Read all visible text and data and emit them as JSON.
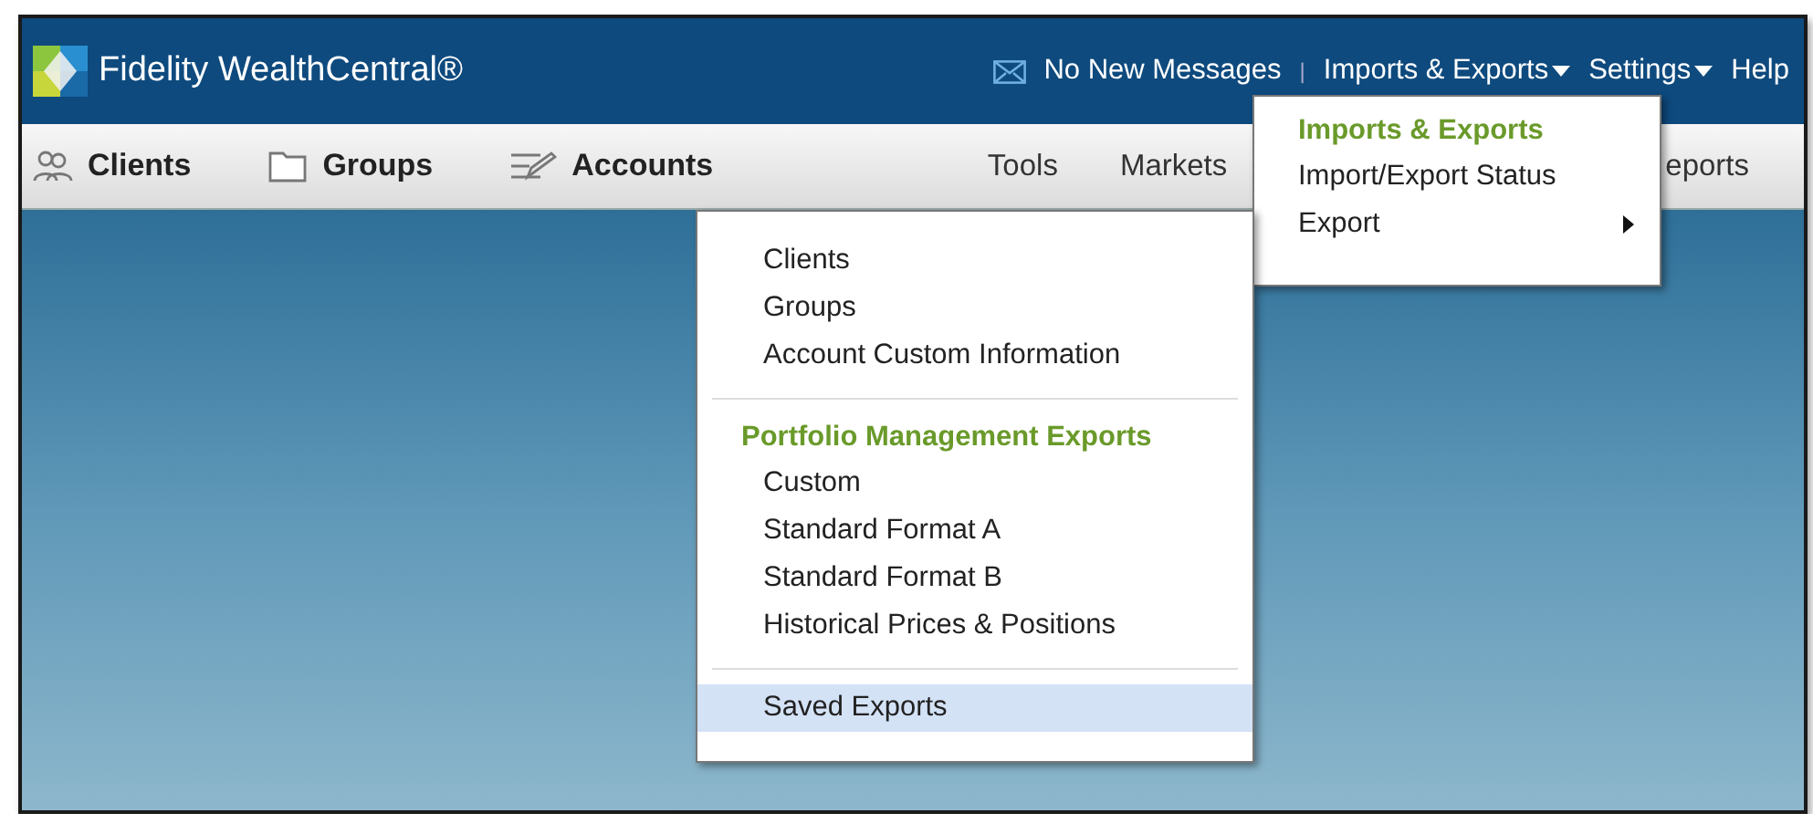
{
  "header": {
    "brand": "Fidelity WealthCentral®",
    "messages": "No New Messages",
    "separator": "|",
    "links": [
      {
        "label": "Imports & Exports",
        "dropdown": true
      },
      {
        "label": "Settings",
        "dropdown": true
      },
      {
        "label": "Help",
        "dropdown": false
      }
    ]
  },
  "nav": {
    "left": [
      {
        "label": "Clients"
      },
      {
        "label": "Groups"
      },
      {
        "label": "Accounts"
      }
    ],
    "right": [
      {
        "label": "Tools"
      },
      {
        "label": "Markets"
      }
    ],
    "cut": "eports"
  },
  "imports_menu": [
    {
      "kind": "heading",
      "label": "Imports & Exports"
    },
    {
      "kind": "item",
      "label": "Import/Export Status",
      "submenu": false,
      "selected": false
    },
    {
      "kind": "item",
      "label": "Export",
      "submenu": true,
      "selected": false
    }
  ],
  "export_menu": [
    {
      "kind": "item",
      "label": "Clients",
      "selected": false
    },
    {
      "kind": "item",
      "label": "Groups",
      "selected": false
    },
    {
      "kind": "item",
      "label": "Account Custom Information",
      "selected": false
    },
    {
      "kind": "divider"
    },
    {
      "kind": "heading",
      "label": "Portfolio Management Exports"
    },
    {
      "kind": "item",
      "label": "Custom",
      "selected": false
    },
    {
      "kind": "item",
      "label": "Standard Format A",
      "selected": false
    },
    {
      "kind": "item",
      "label": "Standard Format B",
      "selected": false
    },
    {
      "kind": "item",
      "label": "Historical Prices & Positions",
      "selected": false
    },
    {
      "kind": "divider"
    },
    {
      "kind": "item",
      "label": "Saved Exports",
      "selected": true
    }
  ]
}
